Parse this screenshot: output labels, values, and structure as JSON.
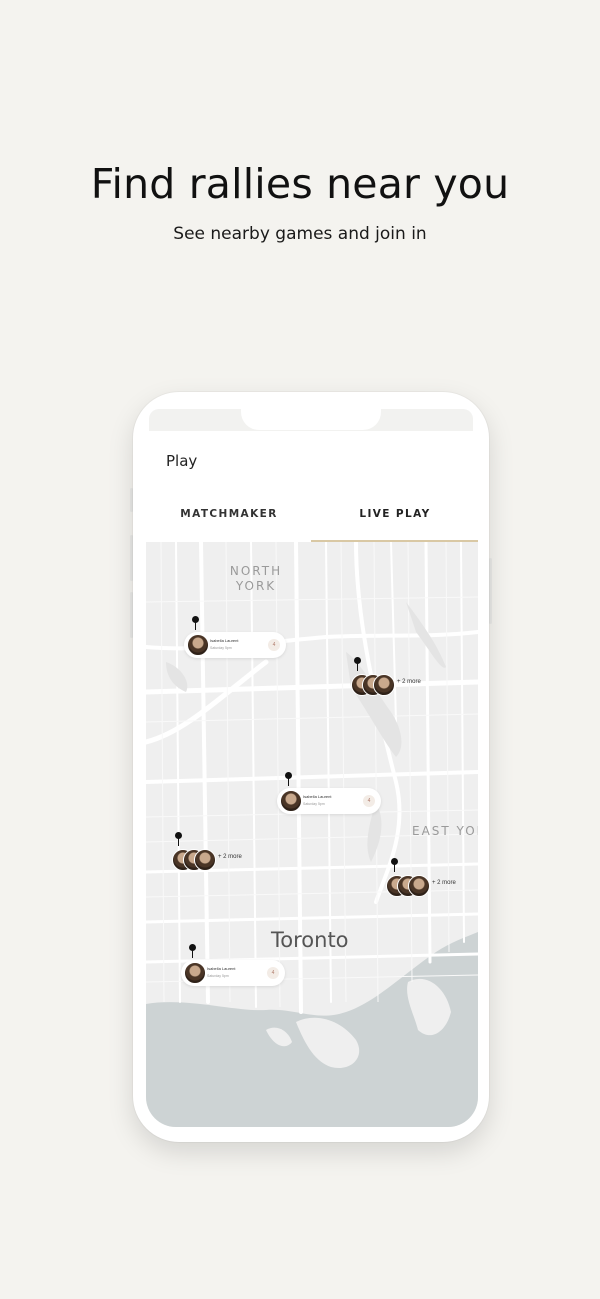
{
  "header": {
    "title": "Find rallies near you",
    "subtitle": "See nearby games and join in"
  },
  "app": {
    "screen_title": "Play",
    "tabs": [
      {
        "label": "MATCHMAKER",
        "active": false
      },
      {
        "label": "LIVE PLAY",
        "active": true
      }
    ],
    "accent_color": "#d9c8a4"
  },
  "map": {
    "region_labels": [
      "NORTH",
      "YORK",
      "EAST YOR"
    ],
    "city_label": "Toronto",
    "cards": [
      {
        "name": "Isabella Laurent",
        "time": "Saturday 5pm",
        "badge": "4"
      },
      {
        "name": "Isabella Laurent",
        "time": "Saturday 5pm",
        "badge": "4"
      },
      {
        "name": "Isabella Laurent",
        "time": "Saturday 5pm",
        "badge": "4"
      }
    ],
    "groups": [
      {
        "more": "+ 2 more"
      },
      {
        "more": "+ 2 more"
      },
      {
        "more": "+ 2 more"
      }
    ]
  }
}
